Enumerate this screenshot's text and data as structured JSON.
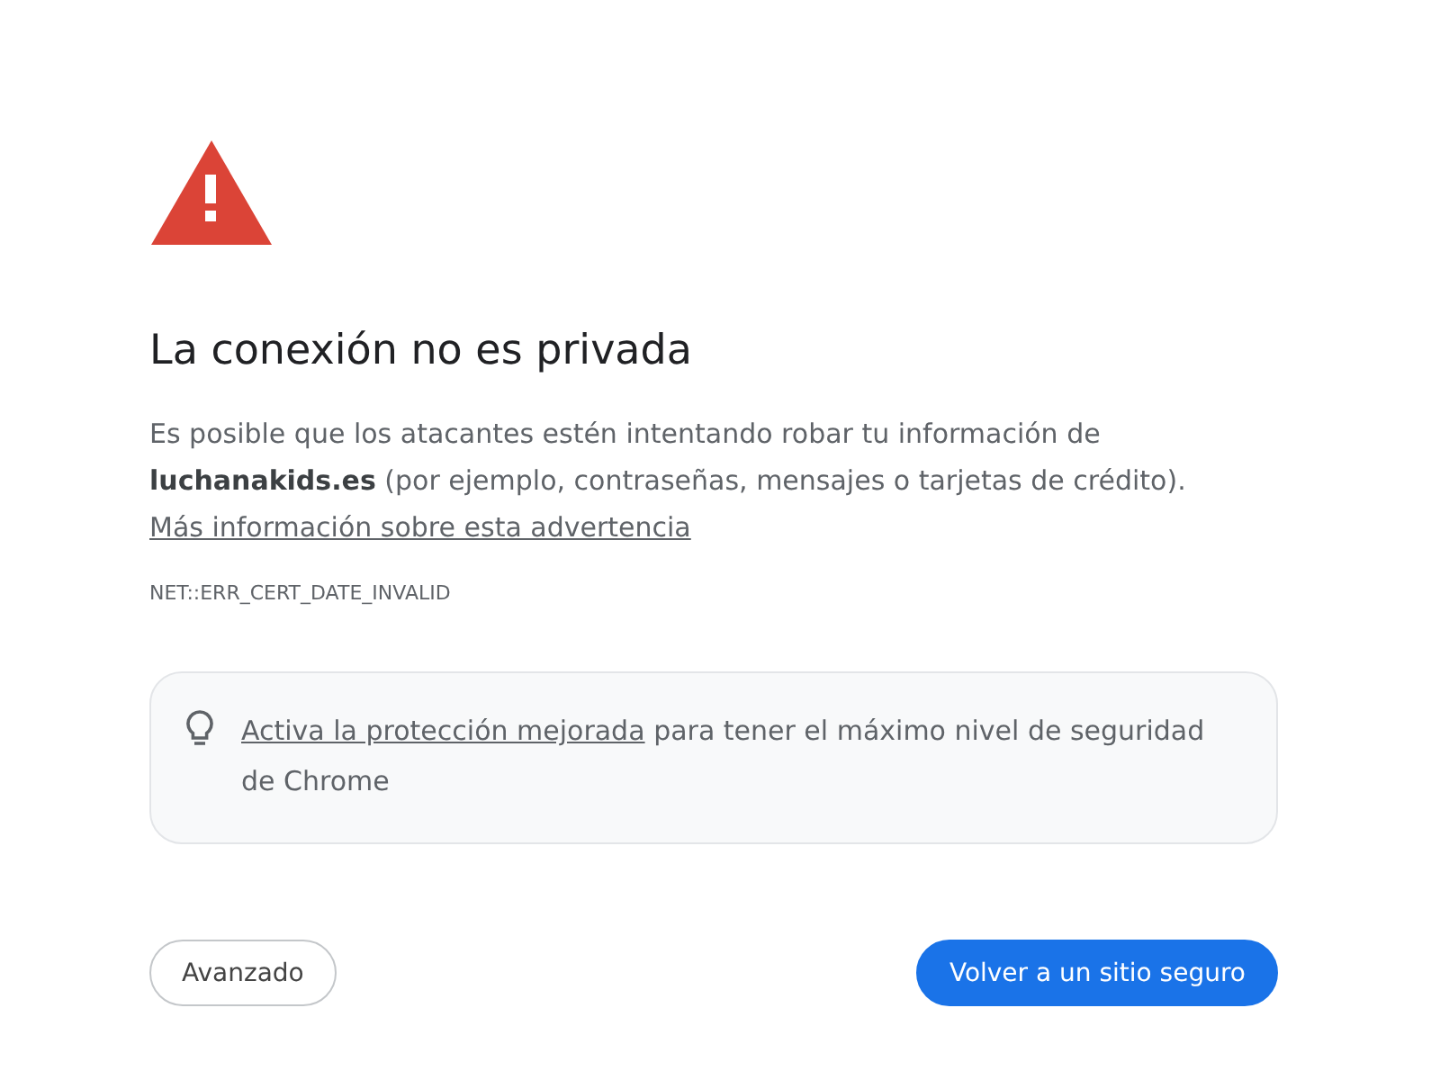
{
  "heading": "La conexión no es privada",
  "description": {
    "text": "Es posible que los atacantes estén intentando robar tu información de **luchanakids.es** (por ejemplo, contraseñas, mensajes o tarjetas de crédito).",
    "link": "Más información sobre esta advertencia"
  },
  "error_code": "NET::ERR_CERT_DATE_INVALID",
  "tip": {
    "link": "Activa la protección mejorada",
    "text": "para tener el máximo nivel de seguridad de Chrome"
  },
  "buttons": [
    {
      "label": "Avanzado",
      "kind": "secondary"
    },
    {
      "label": "Volver a un sitio seguro",
      "kind": "primary"
    }
  ]
}
